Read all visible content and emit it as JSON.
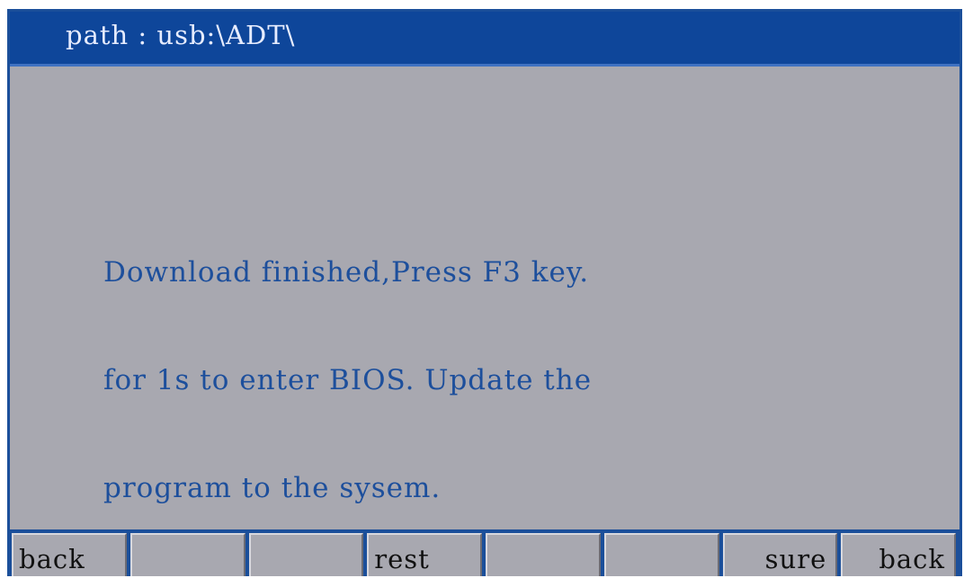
{
  "title_bar": {
    "path_text": "path : usb:\\ADT\\"
  },
  "message": {
    "lines": [
      "Download finished,Press F3 key.",
      "for 1s to enter BIOS. Update the",
      "program to the sysem."
    ]
  },
  "function_keys": [
    {
      "label": "back"
    },
    {
      "label": ""
    },
    {
      "label": ""
    },
    {
      "label": "rest"
    },
    {
      "label": ""
    },
    {
      "label": ""
    },
    {
      "label": "sure"
    },
    {
      "label": "back"
    }
  ],
  "colors": {
    "title_bar_bg": "#0e469a",
    "screen_bg": "#a8a8b0",
    "message_text": "#1d4f9c"
  }
}
